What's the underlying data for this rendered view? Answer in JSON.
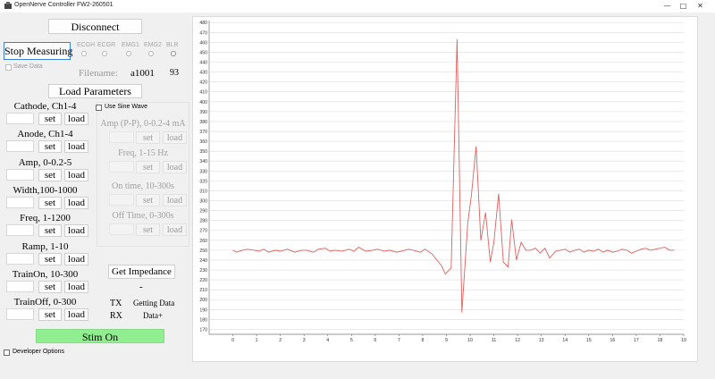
{
  "window": {
    "title": "OpenNerve Controller FW2-260501"
  },
  "controls": {
    "disconnect": "Disconnect",
    "stop_measuring": "Stop Measuring",
    "save_data": "Save Data",
    "channels": [
      "ECGH",
      "ECGR",
      "EMG1",
      "EMG2",
      "BLR"
    ],
    "filename_label": "Filename:",
    "filename_value": "a1001",
    "filename_count": "93",
    "load_parameters": "Load Parameters"
  },
  "params": [
    {
      "label": "Cathode, Ch1-4",
      "value": "",
      "set": "set",
      "load": "load"
    },
    {
      "label": "Anode, Ch1-4",
      "value": "",
      "set": "set",
      "load": "load"
    },
    {
      "label": "Amp, 0-0.2-5",
      "value": "",
      "set": "set",
      "load": "load"
    },
    {
      "label": "Width,100-1000",
      "value": "",
      "set": "set",
      "load": "load"
    },
    {
      "label": "Freq, 1-1200",
      "value": "",
      "set": "set",
      "load": "load"
    },
    {
      "label": "Ramp, 1-10",
      "value": "",
      "set": "set",
      "load": "load"
    },
    {
      "label": "TrainOn, 10-300",
      "value": "",
      "set": "set",
      "load": "load"
    },
    {
      "label": "TrainOff, 0-300",
      "value": "",
      "set": "set",
      "load": "load"
    }
  ],
  "sine": {
    "checkbox": "Use Sine Wave",
    "params": [
      {
        "label": "Amp (P-P), 0-0.2-4 mA",
        "set": "set",
        "load": "load"
      },
      {
        "label": "Freq, 1-15 Hz",
        "set": "set",
        "load": "load"
      },
      {
        "label": "On time, 10-300s",
        "set": "set",
        "load": "load"
      },
      {
        "label": "Off Time, 0-300s",
        "set": "set",
        "load": "load"
      }
    ]
  },
  "impedance": {
    "button": "Get Impedance",
    "value": "-"
  },
  "status": {
    "tx_label": "TX",
    "tx_value": "Getting Data",
    "rx_label": "RX",
    "rx_value": "Data+"
  },
  "stim_button": "Stim On",
  "developer_options": "Developer Options",
  "colors": {
    "stim": "#90ee90",
    "line": "#e06060",
    "grid": "#dcdcdc"
  },
  "chart_data": {
    "type": "line",
    "title": "",
    "xlabel": "",
    "ylabel": "",
    "xlim": [
      -1,
      19
    ],
    "ylim": [
      165,
      482
    ],
    "xticks": [
      0,
      1,
      2,
      3,
      4,
      5,
      6,
      7,
      8,
      9,
      10,
      11,
      12,
      13,
      14,
      15,
      16,
      17,
      18,
      19
    ],
    "yticks": [
      170,
      180,
      190,
      200,
      210,
      220,
      230,
      240,
      250,
      260,
      270,
      280,
      290,
      300,
      310,
      320,
      330,
      340,
      350,
      360,
      370,
      380,
      390,
      400,
      410,
      420,
      430,
      440,
      450,
      460,
      470,
      480
    ],
    "grid": true,
    "series": [
      {
        "x": [
          0,
          0.15,
          0.4,
          0.6,
          0.9,
          1.1,
          1.3,
          1.5,
          1.8,
          2.0,
          2.3,
          2.6,
          2.9,
          3.1,
          3.4,
          3.6,
          3.9,
          4.1,
          4.3,
          4.6,
          4.9,
          5.1,
          5.3,
          5.6,
          5.9,
          6.1,
          6.4,
          6.6,
          6.9,
          7.1,
          7.4,
          7.6,
          7.9,
          8.1,
          8.4,
          8.6,
          8.8,
          8.95,
          9.2,
          9.45,
          9.65,
          9.9,
          10.05,
          10.25,
          10.45,
          10.65,
          10.85,
          11.0,
          11.2,
          11.4,
          11.6,
          11.75,
          11.95,
          12.15,
          12.35,
          12.55,
          12.75,
          12.95,
          13.15,
          13.35,
          13.6,
          13.8,
          14.0,
          14.2,
          14.4,
          14.6,
          14.8,
          15.0,
          15.2,
          15.4,
          15.6,
          15.8,
          16.0,
          16.2,
          16.4,
          16.6,
          16.8,
          17.0,
          17.2,
          17.4,
          17.6,
          17.8,
          18.0,
          18.2,
          18.4,
          18.6
        ],
        "y": [
          250,
          248,
          250,
          251,
          250,
          249,
          251,
          248,
          250,
          249,
          251,
          248,
          250,
          250,
          248,
          251,
          252,
          249,
          250,
          249,
          251,
          249,
          253,
          249,
          250,
          251,
          249,
          250,
          248,
          249,
          251,
          250,
          248,
          251,
          246,
          240,
          234,
          226,
          232,
          463,
          187,
          278,
          305,
          355,
          260,
          288,
          238,
          258,
          307,
          238,
          233,
          281,
          240,
          258,
          250,
          250,
          252,
          247,
          252,
          242,
          249,
          250,
          251,
          248,
          250,
          251,
          248,
          250,
          249,
          251,
          248,
          250,
          248,
          249,
          251,
          250,
          247,
          249,
          251,
          252,
          250,
          251,
          252,
          253,
          250,
          250
        ]
      }
    ]
  }
}
